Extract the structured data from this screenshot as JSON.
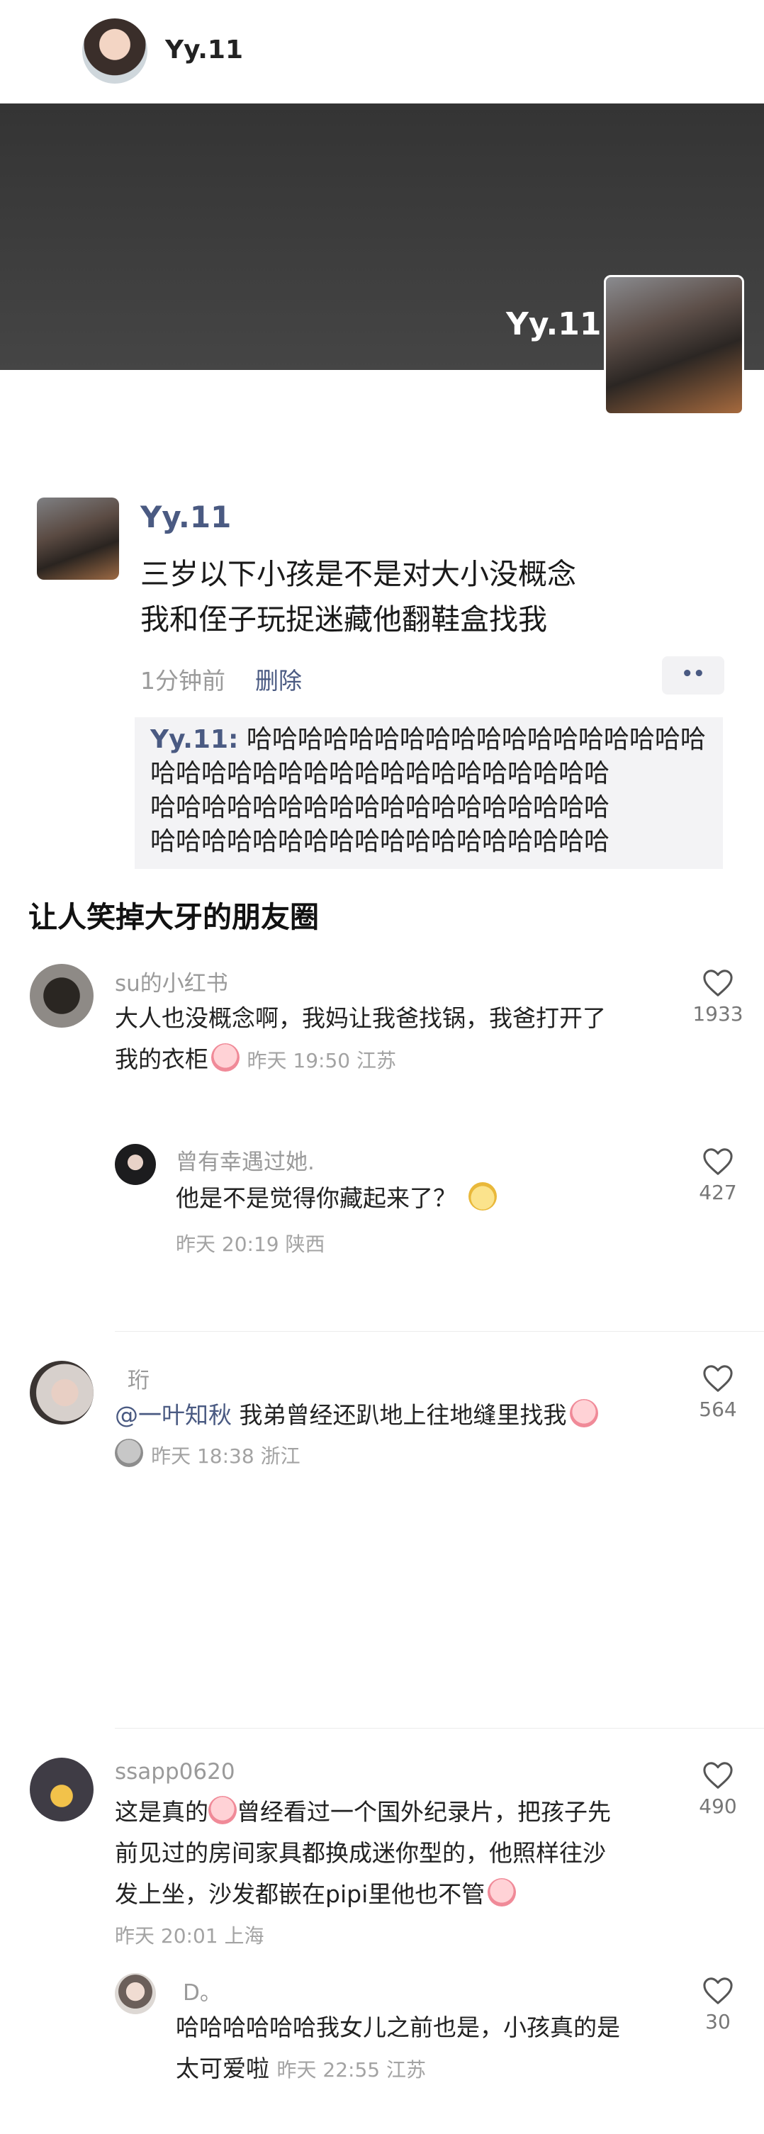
{
  "top_bar": {
    "username": "Yy.11"
  },
  "cover": {
    "name": "Yy.11"
  },
  "moment": {
    "author": "Yy.11",
    "text_line1": "三岁以下小孩是不是对大小没概念",
    "text_line2": "我和侄子玩捉迷藏他翻鞋盒找我",
    "time": "1分钟前",
    "delete_label": "删除",
    "more_label": "••",
    "comment_author": "Yy.11:",
    "comment_line1": "哈哈哈哈哈哈哈哈哈哈哈哈哈哈哈哈哈哈",
    "comment_line2": "哈哈哈哈哈哈哈哈哈哈哈哈哈哈哈哈哈哈",
    "comment_line3": "哈哈哈哈哈哈哈哈哈哈哈哈哈哈哈哈哈哈",
    "comment_line4": "哈哈哈哈哈哈哈哈哈哈哈哈哈哈哈哈哈哈"
  },
  "section_title": "让人笑掉大牙的朋友圈",
  "comments": [
    {
      "name": "su的小红书",
      "line1": "大人也没概念啊，我妈让我爸找锅，我爸打开了",
      "line2": "我的衣柜",
      "meta": "昨天 19:50 江苏",
      "likes": "1933"
    },
    {
      "name": "曾有幸遇过她.",
      "line1": "他是不是觉得你藏起来了？",
      "meta": "昨天 20:19 陕西",
      "likes": "427"
    },
    {
      "name": "珩",
      "mention": "@一叶知秋",
      "line1": " 我弟曾经还趴地上往地缝里找我",
      "meta": "昨天 18:38 浙江",
      "likes": "564"
    },
    {
      "name": "ssapp0620",
      "line1": "这是真的",
      "line1b": "曾经看过一个国外纪录片，把孩子先",
      "line2": "前见过的房间家具都换成迷你型的，他照样往沙",
      "line3": "发上坐，沙发都嵌在pipi里他也不管",
      "meta": "昨天 20:01 上海",
      "likes": "490"
    },
    {
      "name": "D。",
      "line1": "哈哈哈哈哈哈我女儿之前也是，小孩真的是",
      "line2": "太可爱啦",
      "meta": "昨天 22:55 江苏",
      "likes": "30"
    }
  ],
  "colors": {
    "link_blue": "#4a5a82",
    "cover_bg": "#3c3c3c",
    "quote_bg": "#f3f3f5"
  }
}
